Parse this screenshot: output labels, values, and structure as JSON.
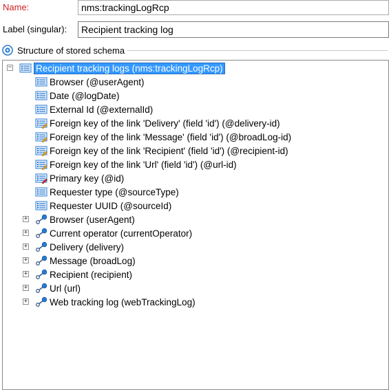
{
  "form": {
    "name_label": "Name:",
    "name_value": "nms:trackingLogRcp",
    "label_label": "Label (singular):",
    "label_value": "Recipient tracking log"
  },
  "section": {
    "title": "Structure of stored schema"
  },
  "tree": {
    "root": {
      "label": "Recipient tracking logs (nms:trackingLogRcp)",
      "expanded": true,
      "selected": true
    },
    "attributes": [
      {
        "label": "Browser (@userAgent)",
        "icon": "attribute-icon"
      },
      {
        "label": "Date (@logDate)",
        "icon": "attribute-icon"
      },
      {
        "label": "External Id (@externalId)",
        "icon": "attribute-icon"
      },
      {
        "label": "Foreign key of the link 'Delivery' (field 'id') (@delivery-id)",
        "icon": "foreign-key-icon"
      },
      {
        "label": "Foreign key of the link 'Message' (field 'id') (@broadLog-id)",
        "icon": "foreign-key-icon"
      },
      {
        "label": "Foreign key of the link 'Recipient' (field 'id') (@recipient-id)",
        "icon": "foreign-key-icon"
      },
      {
        "label": "Foreign key of the link 'Url' (field 'id') (@url-id)",
        "icon": "foreign-key-icon"
      },
      {
        "label": "Primary key (@id)",
        "icon": "primary-key-icon"
      },
      {
        "label": "Requester type (@sourceType)",
        "icon": "attribute-icon"
      },
      {
        "label": "Requester UUID (@sourceId)",
        "icon": "attribute-icon"
      }
    ],
    "links": [
      {
        "label": "Browser (userAgent)",
        "icon": "link-icon"
      },
      {
        "label": "Current operator (currentOperator)",
        "icon": "link-icon"
      },
      {
        "label": "Delivery (delivery)",
        "icon": "link-icon"
      },
      {
        "label": "Message (broadLog)",
        "icon": "link-icon"
      },
      {
        "label": "Recipient (recipient)",
        "icon": "link-icon"
      },
      {
        "label": "Url (url)",
        "icon": "link-icon"
      },
      {
        "label": "Web tracking log (webTrackingLog)",
        "icon": "link-icon"
      }
    ]
  },
  "colors": {
    "name_label": "#d02020",
    "selection": "#3399ff",
    "icon_blue": "#2a7bd1",
    "icon_orange": "#f0a020",
    "icon_red": "#d42a2a"
  }
}
